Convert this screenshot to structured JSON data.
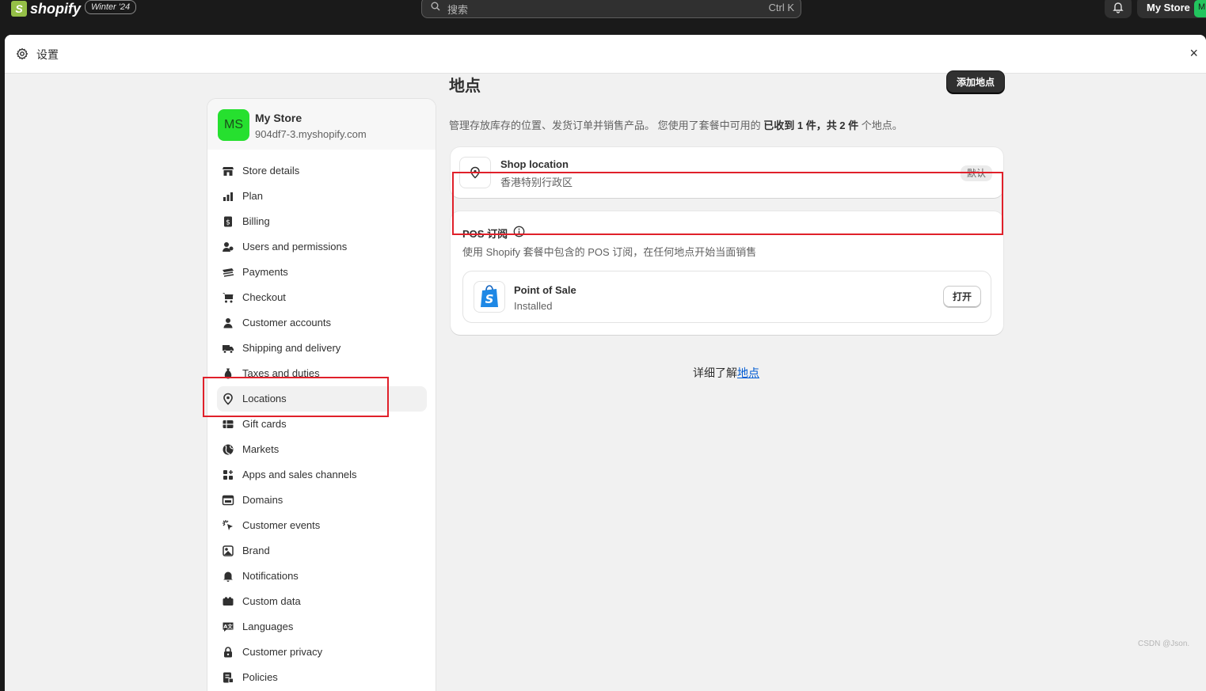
{
  "topbar": {
    "brand": "shopify",
    "edition_badge": "Winter '24",
    "search_placeholder": "搜索",
    "search_shortcut": "Ctrl K",
    "store_button_label": "My Store",
    "store_button_avatar": "M",
    "bell_icon": "bell-icon"
  },
  "modal": {
    "title": "设置",
    "close_glyph": "×"
  },
  "store": {
    "avatar_initials": "MS",
    "name": "My Store",
    "domain": "904df7-3.myshopify.com"
  },
  "sidebar": {
    "items": [
      {
        "label": "Store details",
        "icon": "store-icon"
      },
      {
        "label": "Plan",
        "icon": "plan-icon"
      },
      {
        "label": "Billing",
        "icon": "billing-icon"
      },
      {
        "label": "Users and permissions",
        "icon": "users-icon"
      },
      {
        "label": "Payments",
        "icon": "payments-icon"
      },
      {
        "label": "Checkout",
        "icon": "cart-icon"
      },
      {
        "label": "Customer accounts",
        "icon": "person-icon"
      },
      {
        "label": "Shipping and delivery",
        "icon": "truck-icon"
      },
      {
        "label": "Taxes and duties",
        "icon": "taxes-icon"
      },
      {
        "label": "Locations",
        "icon": "location-pin-icon",
        "active": true
      },
      {
        "label": "Gift cards",
        "icon": "gift-card-icon"
      },
      {
        "label": "Markets",
        "icon": "globe-icon"
      },
      {
        "label": "Apps and sales channels",
        "icon": "apps-icon"
      },
      {
        "label": "Domains",
        "icon": "domains-icon"
      },
      {
        "label": "Customer events",
        "icon": "cursor-icon"
      },
      {
        "label": "Brand",
        "icon": "brand-icon"
      },
      {
        "label": "Notifications",
        "icon": "bell-icon"
      },
      {
        "label": "Custom data",
        "icon": "custom-data-icon"
      },
      {
        "label": "Languages",
        "icon": "language-icon"
      },
      {
        "label": "Customer privacy",
        "icon": "lock-icon"
      },
      {
        "label": "Policies",
        "icon": "policies-icon"
      }
    ]
  },
  "main": {
    "title": "地点",
    "add_button": "添加地点",
    "description_prefix": "管理存放库存的位置、发货订单并销售产品。 您使用了套餐中可用的 ",
    "description_bold": "已收到 1 件，共 2 件",
    "description_suffix": " 个地点。",
    "location": {
      "name": "Shop location",
      "region": "香港特别行政区",
      "badge": "默认"
    },
    "pos": {
      "title": "POS 订阅",
      "subtitle": "使用 Shopify 套餐中包含的 POS 订阅，在任何地点开始当面销售",
      "app_name": "Point of Sale",
      "app_status": "Installed",
      "open_button": "打开"
    },
    "learn_more_prefix": "详细了解",
    "learn_more_link": "地点"
  },
  "watermark": "CSDN @Json.",
  "colors": {
    "topbar_bg": "#1a1a1a",
    "accent_green": "#26e02f",
    "annotation_red": "#e0202a",
    "link_blue": "#005bd3"
  }
}
